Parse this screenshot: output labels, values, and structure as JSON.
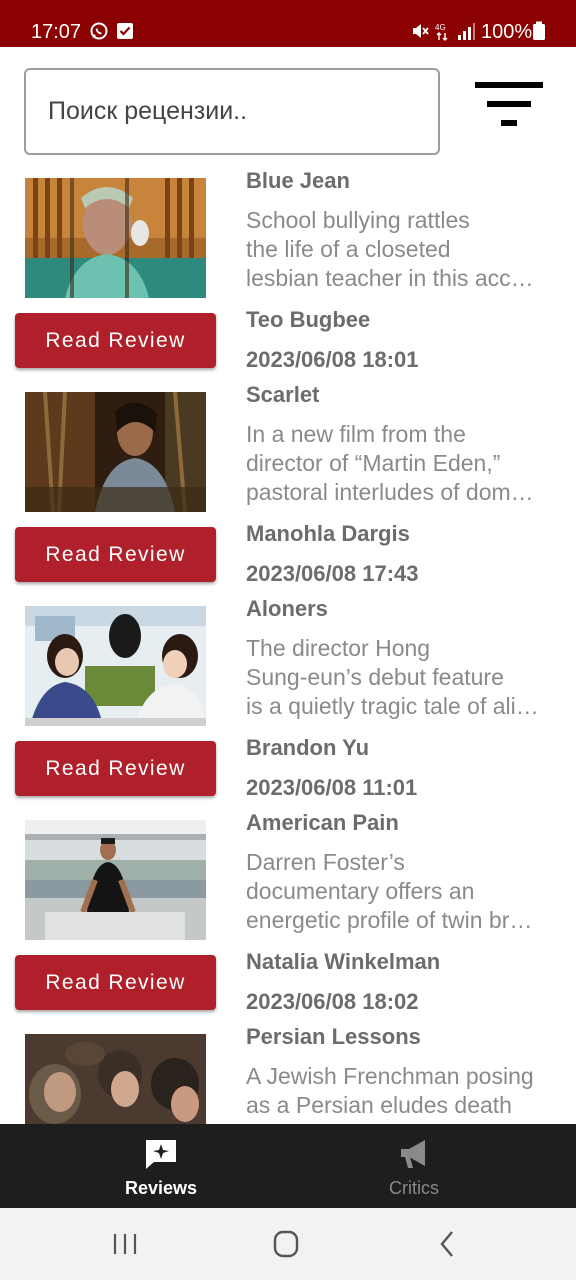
{
  "status_bar": {
    "time": "17:07",
    "battery": "100%",
    "icons": [
      "whatsapp-icon",
      "checkbox-notification-icon",
      "mute-icon",
      "4g-data-icon",
      "signal-icon",
      "battery-icon"
    ]
  },
  "search": {
    "placeholder": "Поиск рецензии..",
    "value": ""
  },
  "filter_icon": "filter-icon",
  "colors": {
    "status_bar": "#8b0000",
    "button": "#b0202a",
    "bottom_nav": "#1e1e1e",
    "nav_active": "#ffffff",
    "nav_inactive": "#8a8a8a"
  },
  "reviews": [
    {
      "title": "Blue Jean",
      "description": [
        "School bullying rattles",
        "the life of a closeted",
        "lesbian teacher in this acc…"
      ],
      "author": "Teo Bugbee",
      "date": "2023/06/08 18:01",
      "button_label": "Read Review"
    },
    {
      "title": "Scarlet",
      "description": [
        "In a new film from the",
        "director of “Martin Eden,”",
        "pastoral interludes of dom…"
      ],
      "author": "Manohla Dargis",
      "date": "2023/06/08 17:43",
      "button_label": "Read Review"
    },
    {
      "title": "Aloners",
      "description": [
        "The director Hong",
        "Sung-eun’s debut feature",
        "is a quietly tragic tale of ali…"
      ],
      "author": "Brandon Yu",
      "date": "2023/06/08 11:01",
      "button_label": "Read Review"
    },
    {
      "title": "American Pain",
      "description": [
        "Darren Foster’s",
        "documentary offers an",
        "energetic profile of twin br…"
      ],
      "author": "Natalia Winkelman",
      "date": "2023/06/08 18:02",
      "button_label": "Read Review"
    },
    {
      "title": "Persian Lessons",
      "description": [
        "A Jewish Frenchman posing",
        "as a Persian eludes death"
      ],
      "author": "",
      "date": "",
      "button_label": ""
    }
  ],
  "bottom_nav": {
    "tabs": [
      {
        "label": "Reviews",
        "icon": "reviews-icon",
        "active": true
      },
      {
        "label": "Critics",
        "icon": "megaphone-icon",
        "active": false
      }
    ]
  },
  "system_nav": {
    "buttons": [
      "recents-icon",
      "home-icon",
      "back-icon"
    ]
  }
}
